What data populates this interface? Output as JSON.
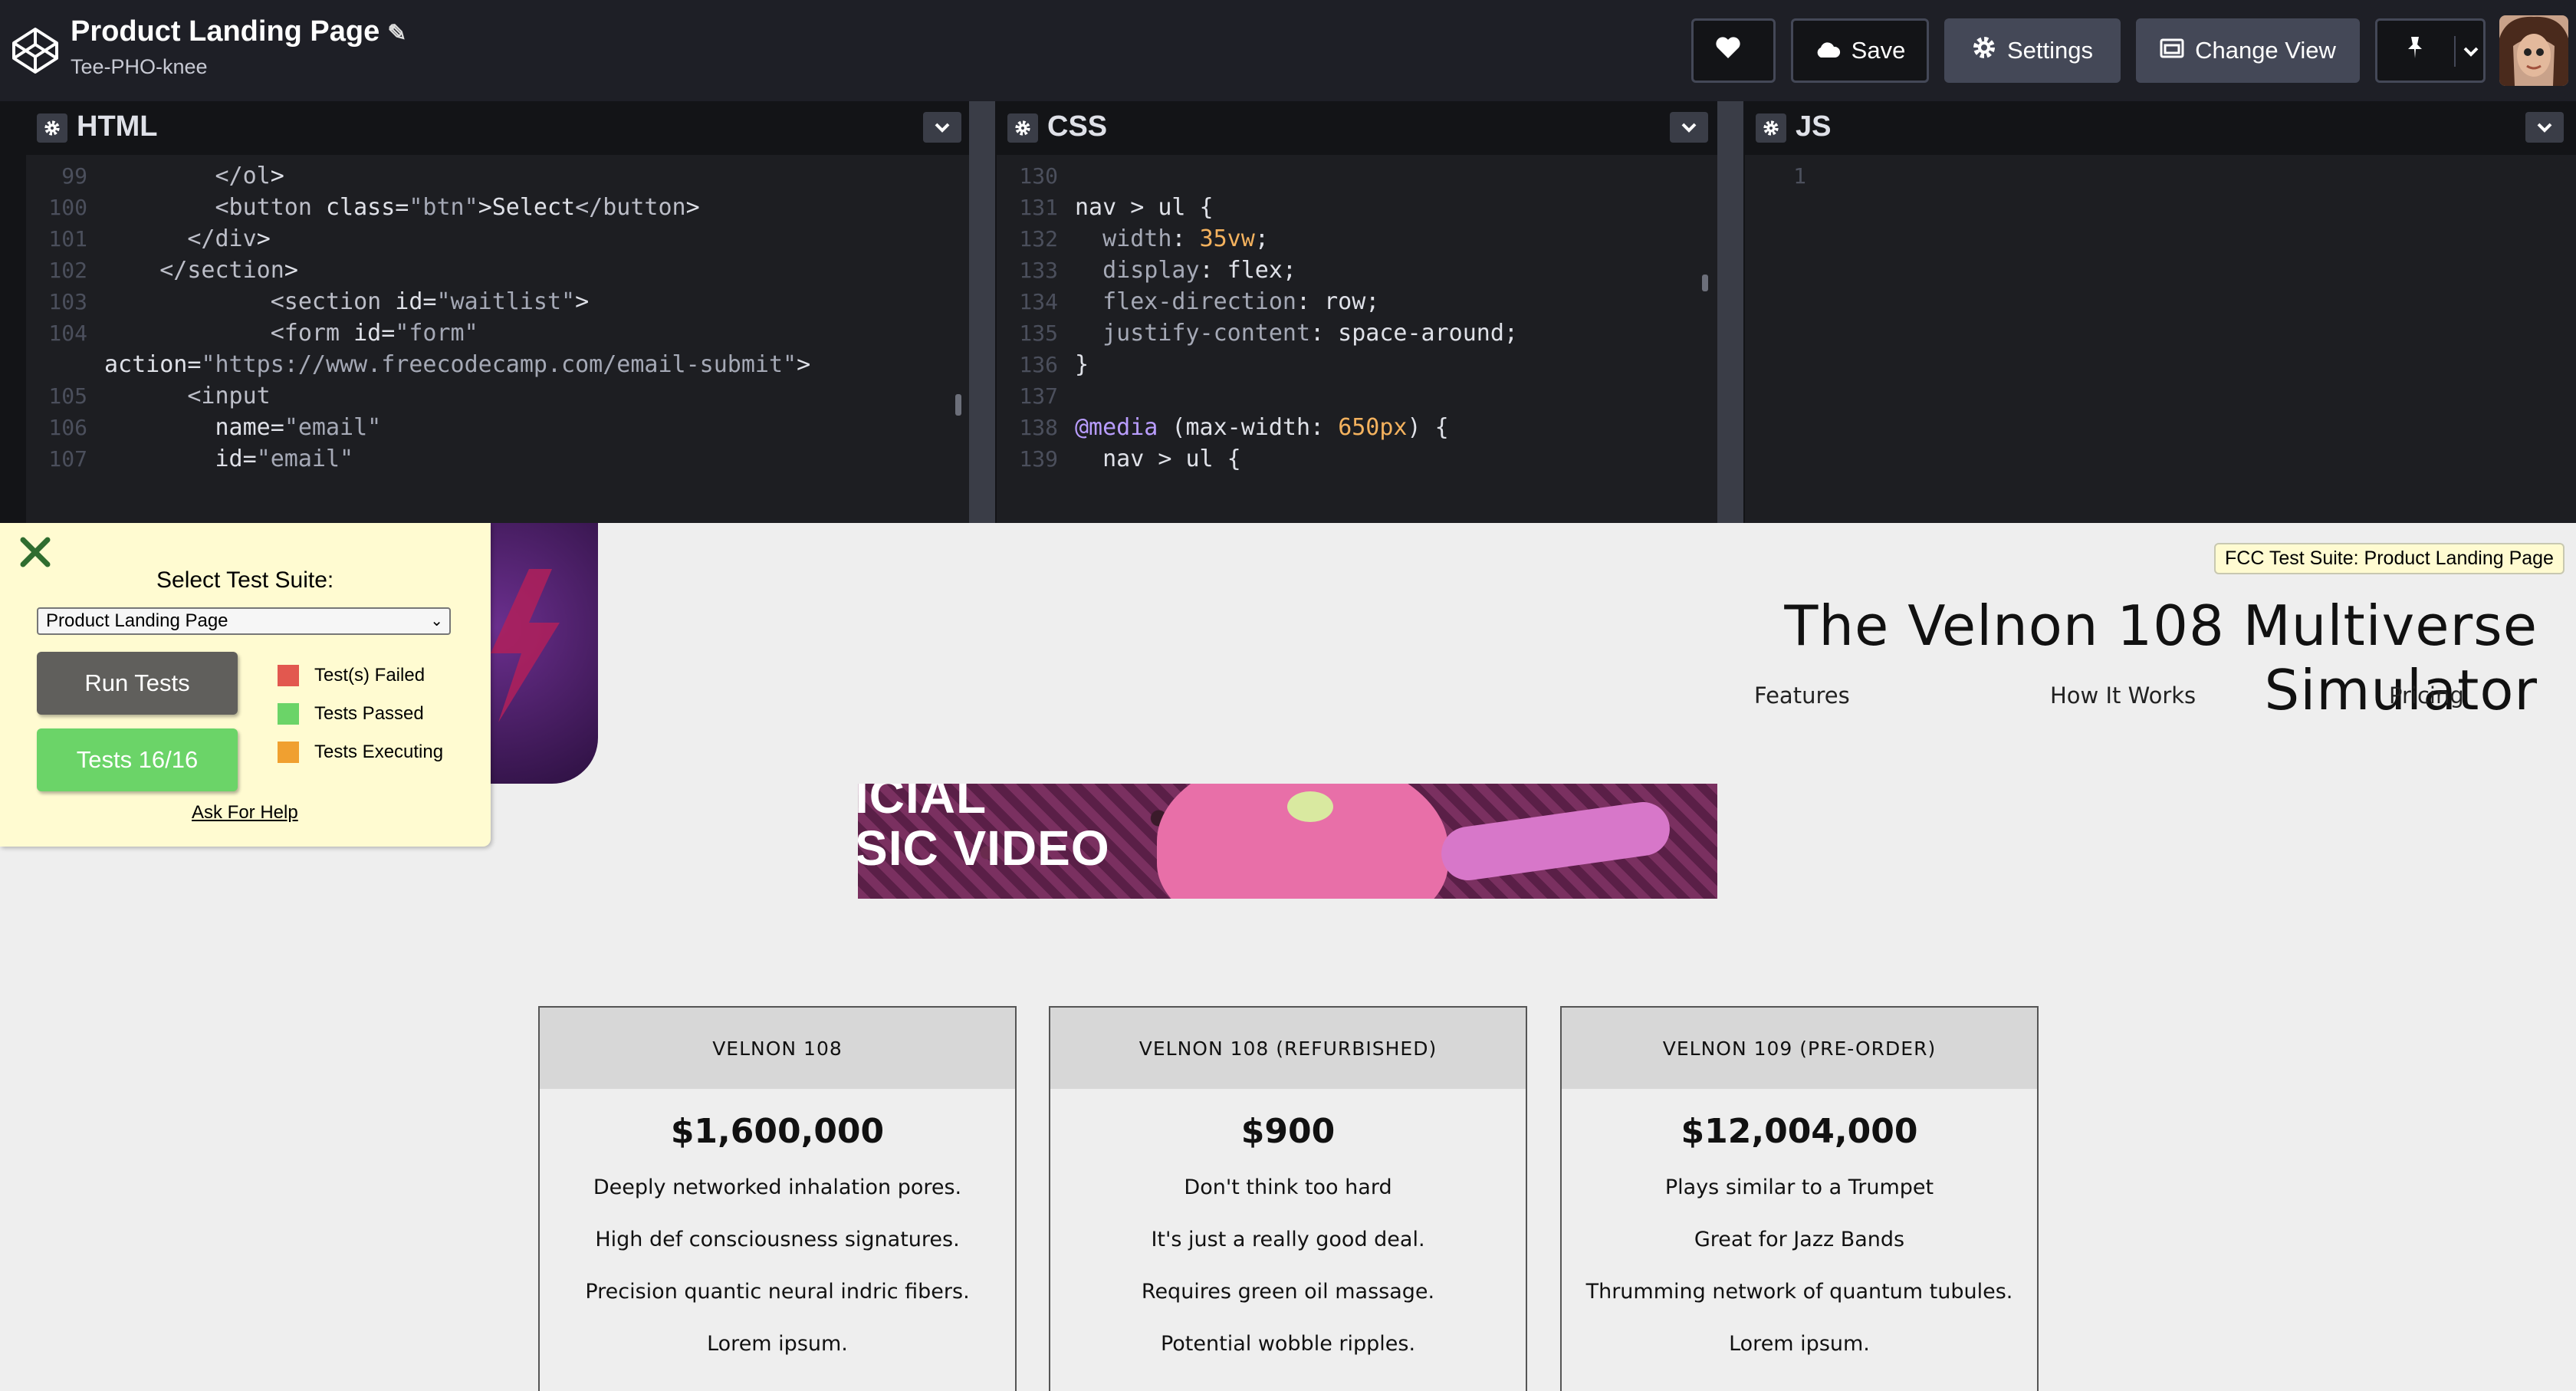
{
  "header": {
    "title": "Product Landing Page",
    "author": "Tee-PHO-knee",
    "buttons": {
      "save": "Save",
      "settings": "Settings",
      "change_view": "Change View"
    }
  },
  "editors": {
    "html": {
      "title": "HTML",
      "lines": [
        {
          "n": "99",
          "t": "        </ol>"
        },
        {
          "n": "100",
          "t": "        <button class=\"btn\">Select</button>"
        },
        {
          "n": "101",
          "t": "      </div>"
        },
        {
          "n": "102",
          "t": "    </section>"
        },
        {
          "n": "103",
          "t": "            <section id=\"waitlist\">"
        },
        {
          "n": "104",
          "t": "            <form id=\"form\""
        },
        {
          "n": "",
          "t": "action=\"https://www.freecodecamp.com/email-submit\">"
        },
        {
          "n": "105",
          "t": "      <input"
        },
        {
          "n": "106",
          "t": "        name=\"email\""
        },
        {
          "n": "107",
          "t": "        id=\"email\""
        }
      ]
    },
    "css": {
      "title": "CSS",
      "lines": [
        {
          "n": "130",
          "t": ""
        },
        {
          "n": "131",
          "t": "nav > ul {"
        },
        {
          "n": "132",
          "t": "  width: 35vw;"
        },
        {
          "n": "133",
          "t": "  display: flex;"
        },
        {
          "n": "134",
          "t": "  flex-direction: row;"
        },
        {
          "n": "135",
          "t": "  justify-content: space-around;"
        },
        {
          "n": "136",
          "t": "}"
        },
        {
          "n": "137",
          "t": ""
        },
        {
          "n": "138",
          "t": "@media (max-width: 650px) {"
        },
        {
          "n": "139",
          "t": "  nav > ul {"
        }
      ]
    },
    "js": {
      "title": "JS",
      "lines": [
        {
          "n": "1",
          "t": ""
        }
      ]
    }
  },
  "preview": {
    "fcc_badge": "FCC Test Suite: Product Landing Page",
    "site_title": "The Velnon 108 Multiverse Simulator",
    "nav": [
      "Features",
      "How It Works",
      "Pricing"
    ],
    "video_text": [
      "ICIAL",
      "SIC VIDEO"
    ],
    "pricing": [
      {
        "name": "VELNON 108",
        "price": "$1,600,000",
        "features": [
          "Deeply networked inhalation pores.",
          "High def consciousness signatures.",
          "Precision quantic neural indric fibers.",
          "Lorem ipsum."
        ]
      },
      {
        "name": "VELNON 108 (REFURBISHED)",
        "price": "$900",
        "features": [
          "Don't think too hard",
          "It's just a really good deal.",
          "Requires green oil massage.",
          "Potential wobble ripples."
        ]
      },
      {
        "name": "VELNON 109 (PRE-ORDER)",
        "price": "$12,004,000",
        "features": [
          "Plays similar to a Trumpet",
          "Great for Jazz Bands",
          "Thrumming network of quantum tubules.",
          "Lorem ipsum."
        ]
      }
    ]
  },
  "test_suite": {
    "label": "Select Test Suite:",
    "selected": "Product Landing Page",
    "run_button": "Run Tests",
    "tests_button": "Tests 16/16",
    "legend": [
      {
        "label": "Test(s) Failed",
        "color": "#e2584f"
      },
      {
        "label": "Tests Passed",
        "color": "#6bd468"
      },
      {
        "label": "Tests Executing",
        "color": "#f0a030"
      }
    ],
    "help": "Ask For Help"
  },
  "colors": {
    "topbar": "#1e1f26",
    "button": "#444857",
    "editor_bg": "#1d1e22",
    "suite_bg": "#fffbd1"
  }
}
